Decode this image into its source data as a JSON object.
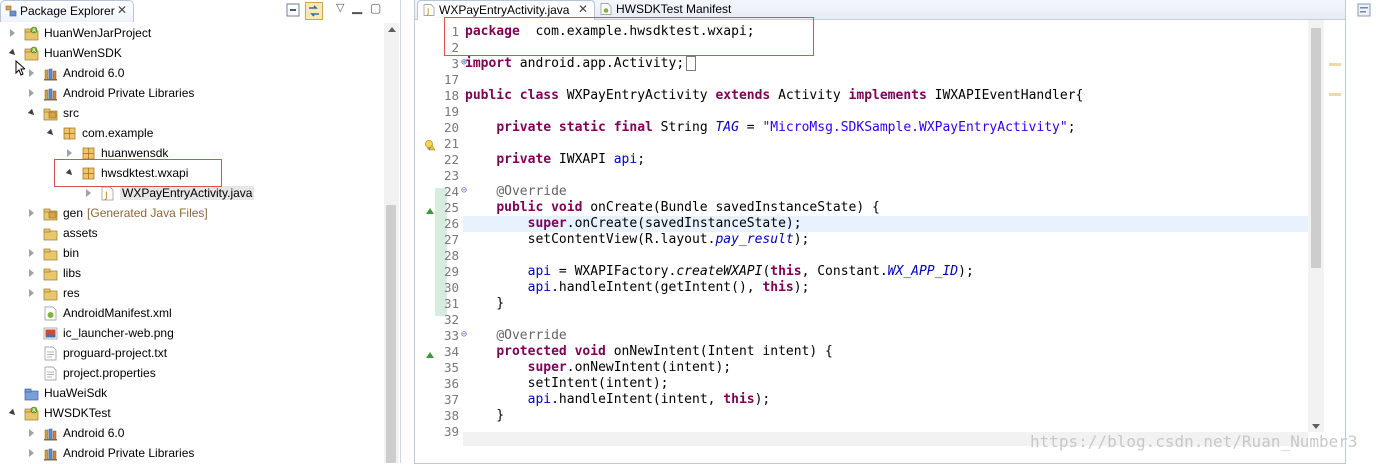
{
  "package_explorer": {
    "tab_label": "Package Explorer",
    "tree": [
      {
        "label": "HuanWenJarProject",
        "icon": "project-icon",
        "indent": 0,
        "twisty": "closed"
      },
      {
        "label": "HuanWenSDK",
        "icon": "project-icon",
        "indent": 0,
        "twisty": "open"
      },
      {
        "label": "Android 6.0",
        "icon": "library-icon",
        "indent": 1,
        "twisty": "closed"
      },
      {
        "label": "Android Private Libraries",
        "icon": "library-icon",
        "indent": 1,
        "twisty": "closed"
      },
      {
        "label": "src",
        "icon": "source-folder-icon",
        "indent": 1,
        "twisty": "open"
      },
      {
        "label": "com.example",
        "icon": "package-icon",
        "indent": 2,
        "twisty": "open"
      },
      {
        "label": "huanwensdk",
        "icon": "package-icon",
        "indent": 3,
        "twisty": "closed"
      },
      {
        "label": "hwsdktest.wxapi",
        "icon": "package-icon",
        "indent": 3,
        "twisty": "open"
      },
      {
        "label": "WXPayEntryActivity.java",
        "icon": "java-file-icon",
        "indent": 4,
        "twisty": "closed"
      },
      {
        "label": "gen",
        "decoration": "[Generated Java Files]",
        "icon": "source-folder-icon",
        "indent": 1,
        "twisty": "closed"
      },
      {
        "label": "assets",
        "icon": "folder-icon",
        "indent": 1,
        "twisty": "none"
      },
      {
        "label": "bin",
        "icon": "folder-icon",
        "indent": 1,
        "twisty": "closed"
      },
      {
        "label": "libs",
        "icon": "folder-icon",
        "indent": 1,
        "twisty": "closed"
      },
      {
        "label": "res",
        "icon": "folder-icon",
        "indent": 1,
        "twisty": "closed"
      },
      {
        "label": "AndroidManifest.xml",
        "icon": "xml-file-icon",
        "indent": 1,
        "twisty": "none"
      },
      {
        "label": "ic_launcher-web.png",
        "icon": "image-file-icon",
        "indent": 1,
        "twisty": "none"
      },
      {
        "label": "proguard-project.txt",
        "icon": "text-file-icon",
        "indent": 1,
        "twisty": "none"
      },
      {
        "label": "project.properties",
        "icon": "text-file-icon",
        "indent": 1,
        "twisty": "none"
      },
      {
        "label": "HuaWeiSdk",
        "icon": "project-icon-plain",
        "indent": 0,
        "twisty": "none"
      },
      {
        "label": "HWSDKTest",
        "icon": "project-icon",
        "indent": 0,
        "twisty": "open"
      },
      {
        "label": "Android 6.0",
        "icon": "library-icon",
        "indent": 1,
        "twisty": "closed"
      },
      {
        "label": "Android Private Libraries",
        "icon": "library-icon",
        "indent": 1,
        "twisty": "closed"
      }
    ]
  },
  "editor": {
    "tabs": [
      {
        "label": "WXPayEntryActivity.java",
        "active": true
      },
      {
        "label": "HWSDKTest Manifest",
        "active": false
      }
    ],
    "lines": [
      {
        "n": "1",
        "tokens": [
          [
            "kw",
            "package"
          ],
          [
            "",
            "  com.example.hwsdktest.wxapi;"
          ]
        ]
      },
      {
        "n": "2",
        "tokens": []
      },
      {
        "n": "3",
        "fold": "plus",
        "tokens": [
          [
            "kw",
            "import"
          ],
          [
            "",
            " android.app.Activity;"
          ]
        ]
      },
      {
        "n": "17",
        "tokens": []
      },
      {
        "n": "18",
        "tokens": [
          [
            "kw",
            "public class"
          ],
          [
            "",
            " WXPayEntryActivity "
          ],
          [
            "kw",
            "extends"
          ],
          [
            "",
            " Activity "
          ],
          [
            "kw",
            "implements"
          ],
          [
            "",
            " IWXAPIEventHandler{"
          ]
        ]
      },
      {
        "n": "19",
        "tokens": []
      },
      {
        "n": "20",
        "tokens": [
          [
            "",
            "    "
          ],
          [
            "kw",
            "private static final"
          ],
          [
            "",
            " String "
          ],
          [
            "sfld",
            "TAG"
          ],
          [
            "",
            " = "
          ],
          [
            "str",
            "\"MicroMsg.SDKSample.WXPayEntryActivity\""
          ],
          [
            "",
            ";"
          ]
        ]
      },
      {
        "n": "21",
        "tokens": []
      },
      {
        "n": "22",
        "tokens": [
          [
            "",
            "    "
          ],
          [
            "kw",
            "private"
          ],
          [
            "",
            " IWXAPI "
          ],
          [
            "fld",
            "api"
          ],
          [
            "",
            ";"
          ]
        ]
      },
      {
        "n": "23",
        "tokens": []
      },
      {
        "n": "24",
        "fold": "minus",
        "tokens": [
          [
            "",
            "    "
          ],
          [
            "ann",
            "@Override"
          ]
        ]
      },
      {
        "n": "25",
        "tokens": [
          [
            "",
            "    "
          ],
          [
            "kw",
            "public void"
          ],
          [
            "",
            " onCreate(Bundle savedInstanceState) {"
          ]
        ]
      },
      {
        "n": "26",
        "tokens": [
          [
            "",
            "        "
          ],
          [
            "kw",
            "super"
          ],
          [
            "",
            ".onCreate(savedInstanceState);"
          ]
        ]
      },
      {
        "n": "27",
        "tokens": [
          [
            "",
            "        setContentView(R.layout."
          ],
          [
            "sfld",
            "pay_result"
          ],
          [
            "",
            ");"
          ]
        ]
      },
      {
        "n": "28",
        "tokens": []
      },
      {
        "n": "29",
        "tokens": [
          [
            "",
            "        "
          ],
          [
            "fld",
            "api"
          ],
          [
            "",
            " = WXAPIFactory."
          ],
          [
            "smeth",
            "createWXAPI"
          ],
          [
            "",
            "("
          ],
          [
            "kw",
            "this"
          ],
          [
            "",
            ", Constant."
          ],
          [
            "sfld",
            "WX_APP_ID"
          ],
          [
            "",
            ");"
          ]
        ]
      },
      {
        "n": "30",
        "tokens": [
          [
            "",
            "        "
          ],
          [
            "fld",
            "api"
          ],
          [
            "",
            ".handleIntent(getIntent(), "
          ],
          [
            "kw",
            "this"
          ],
          [
            "",
            ");"
          ]
        ]
      },
      {
        "n": "31",
        "tokens": [
          [
            "",
            "    }"
          ]
        ]
      },
      {
        "n": "32",
        "tokens": []
      },
      {
        "n": "33",
        "fold": "minus",
        "tokens": [
          [
            "",
            "    "
          ],
          [
            "ann",
            "@Override"
          ]
        ]
      },
      {
        "n": "34",
        "tokens": [
          [
            "",
            "    "
          ],
          [
            "kw",
            "protected void"
          ],
          [
            "",
            " onNewIntent(Intent intent) {"
          ]
        ]
      },
      {
        "n": "35",
        "tokens": [
          [
            "",
            "        "
          ],
          [
            "kw",
            "super"
          ],
          [
            "",
            ".onNewIntent(intent);"
          ]
        ]
      },
      {
        "n": "36",
        "tokens": [
          [
            "",
            "        setIntent(intent);"
          ]
        ]
      },
      {
        "n": "37",
        "tokens": [
          [
            "",
            "        "
          ],
          [
            "fld",
            "api"
          ],
          [
            "",
            ".handleIntent(intent, "
          ],
          [
            "kw",
            "this"
          ],
          [
            "",
            ");"
          ]
        ]
      },
      {
        "n": "38",
        "tokens": [
          [
            "",
            "    }"
          ]
        ]
      },
      {
        "n": "39",
        "tokens": []
      }
    ]
  },
  "watermark": "https://blog.csdn.net/Ruan_Number3",
  "colors": {
    "keyword": "#7f0055",
    "string": "#2a00ff",
    "field": "#0000c0",
    "annotation": "#646464",
    "highlight_box": "#e05050"
  }
}
